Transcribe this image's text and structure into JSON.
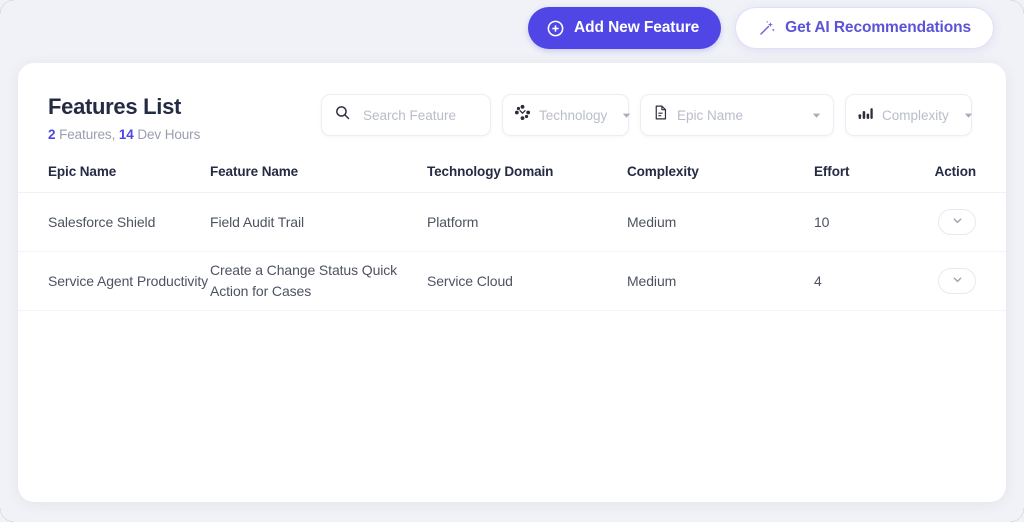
{
  "topbar": {
    "add_feature_label": "Add New Feature",
    "add_feature_icon": "plus-circle-icon",
    "ai_recommendations_label": "Get AI Recommendations",
    "ai_recommendations_icon": "magic-wand-icon",
    "primary_color": "#4f46e5",
    "secondary_text_color": "#5b53d8"
  },
  "card": {
    "title": "Features List",
    "stats": {
      "features_count": "2",
      "features_label": "Features",
      "separator": ",",
      "dev_hours_count": "14",
      "dev_hours_label": "Dev Hours"
    }
  },
  "filters": {
    "search": {
      "placeholder": "Search Feature",
      "value": "",
      "icon": "search-icon"
    },
    "dropdowns": [
      {
        "label": "Technology",
        "icon": "technology-node-icon"
      },
      {
        "label": "Epic Name",
        "icon": "document-icon"
      },
      {
        "label": "Complexity",
        "icon": "bar-chart-icon"
      }
    ]
  },
  "table": {
    "columns": [
      "Epic Name",
      "Feature Name",
      "Technology Domain",
      "Complexity",
      "Effort",
      "Action"
    ],
    "rows": [
      {
        "epic_name": "Salesforce Shield",
        "feature_name": "Field Audit Trail",
        "technology_domain": "Platform",
        "complexity": "Medium",
        "effort": "10",
        "action_icon": "chevron-down-icon"
      },
      {
        "epic_name": "Service Agent Productivity",
        "feature_name": "Create a Change Status Quick Action for Cases",
        "technology_domain": "Service Cloud",
        "complexity": "Medium",
        "effort": "4",
        "action_icon": "chevron-down-icon"
      }
    ]
  }
}
